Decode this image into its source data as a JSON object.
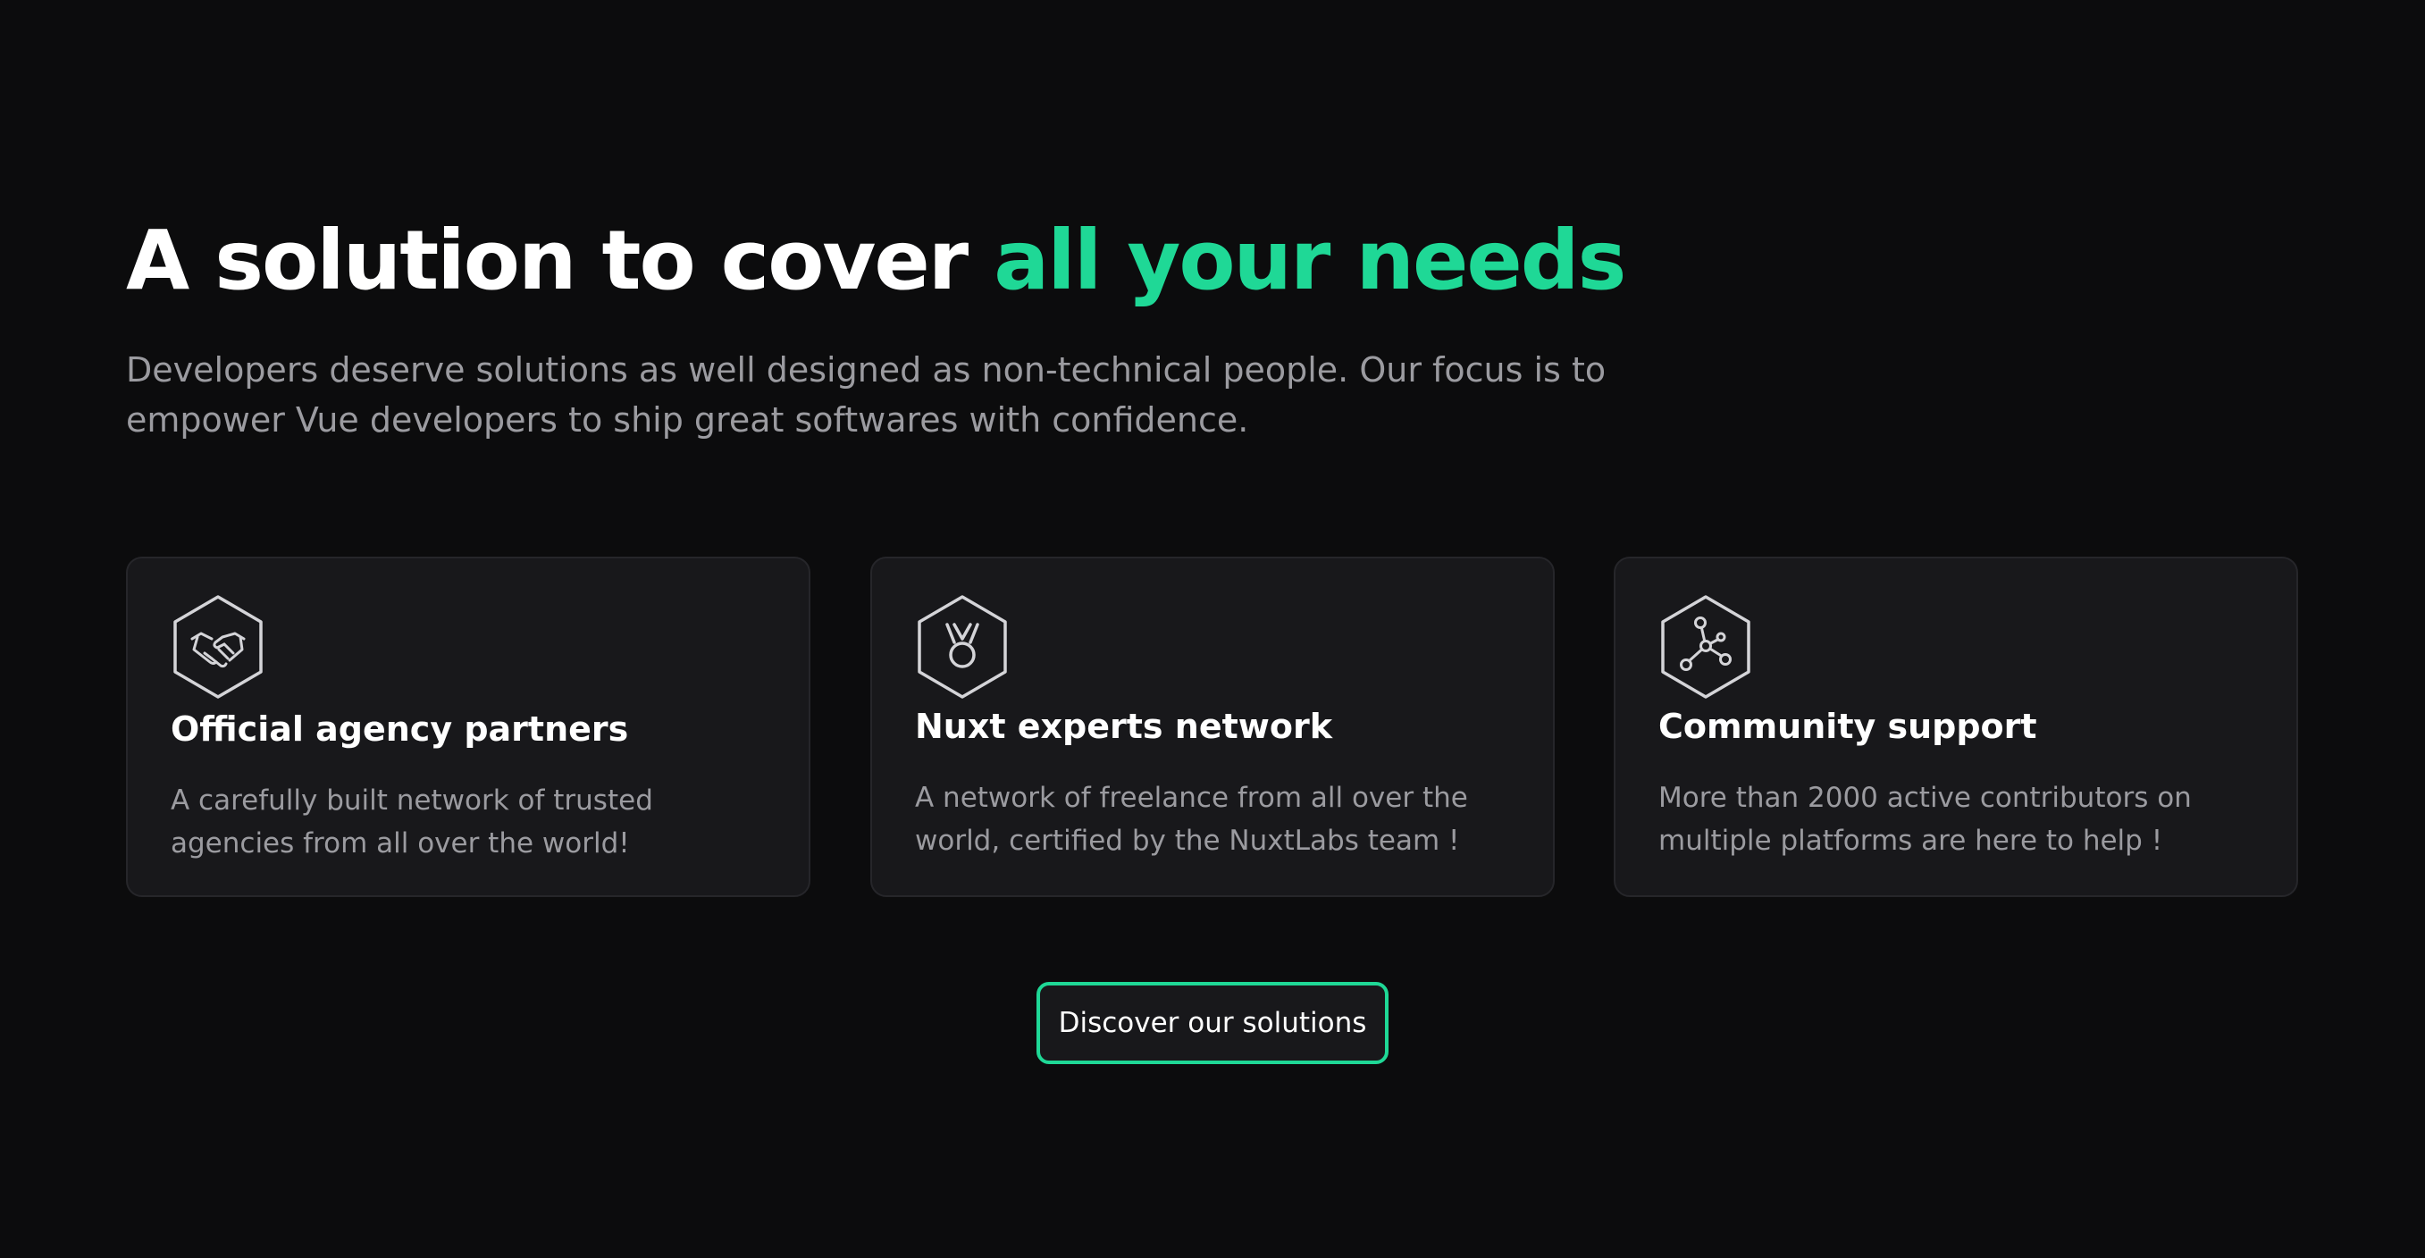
{
  "hero": {
    "title_main": "A solution to cover ",
    "title_accent": "all your needs",
    "subtitle": "Developers deserve solutions as well designed as non-technical people. Our focus is to empower Vue developers to ship great softwares with confidence."
  },
  "cards": [
    {
      "icon": "handshake-icon",
      "title": "Official agency partners",
      "description": "A carefully built network of trusted agencies from all over the world!"
    },
    {
      "icon": "medal-icon",
      "title": "Nuxt experts network",
      "description": "A network of freelance from all over the world, certified by the NuxtLabs team !"
    },
    {
      "icon": "network-icon",
      "title": "Community support",
      "description": "More than 2000 active contributors on multiple platforms are here to help !"
    }
  ],
  "cta": {
    "label": "Discover our solutions"
  },
  "colors": {
    "background": "#0c0c0d",
    "card_background": "#18181b",
    "accent": "#1fd896",
    "muted_text": "#9b9ba0"
  }
}
